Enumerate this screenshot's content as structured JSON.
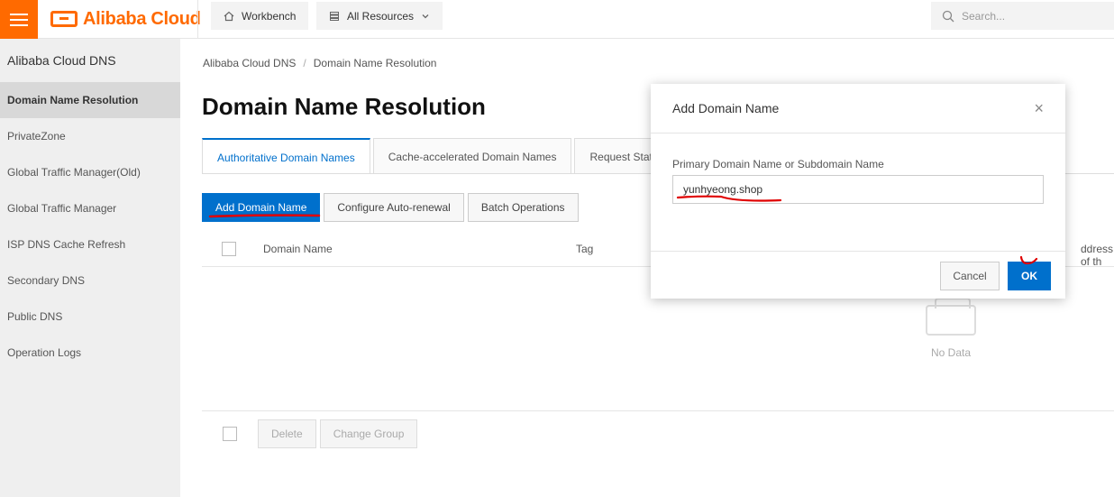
{
  "topbar": {
    "brand": "Alibaba Cloud",
    "workbench_label": "Workbench",
    "resources_label": "All Resources",
    "search_placeholder": "Search..."
  },
  "sidebar": {
    "title": "Alibaba Cloud DNS",
    "items": [
      {
        "label": "Domain Name Resolution",
        "active": true
      },
      {
        "label": "PrivateZone"
      },
      {
        "label": "Global Traffic Manager(Old)"
      },
      {
        "label": "Global Traffic Manager"
      },
      {
        "label": "ISP DNS Cache Refresh"
      },
      {
        "label": "Secondary DNS"
      },
      {
        "label": "Public DNS"
      },
      {
        "label": "Operation Logs"
      }
    ]
  },
  "breadcrumb": [
    "Alibaba Cloud DNS",
    "/",
    "Domain Name Resolution"
  ],
  "page_title": "Domain Name Resolution",
  "tabs": [
    "Authoritative Domain Names",
    "Cache-accelerated Domain Names",
    "Request Stati"
  ],
  "actions": {
    "add": "Add Domain Name",
    "auto_renew": "Configure Auto-renewal",
    "batch": "Batch Operations"
  },
  "table": {
    "columns": [
      "Domain Name",
      "Tag",
      "ddress of th"
    ],
    "empty_text": "No Data"
  },
  "footer_actions": {
    "delete": "Delete",
    "change_group": "Change Group"
  },
  "dialog": {
    "title": "Add Domain Name",
    "close": "×",
    "field_label": "Primary Domain Name or Subdomain Name",
    "field_value": "yunhyeong.shop",
    "cancel": "Cancel",
    "ok": "OK"
  },
  "colors": {
    "brand": "#ff6a00",
    "primary": "#0070cc",
    "annotation": "#e00000"
  }
}
